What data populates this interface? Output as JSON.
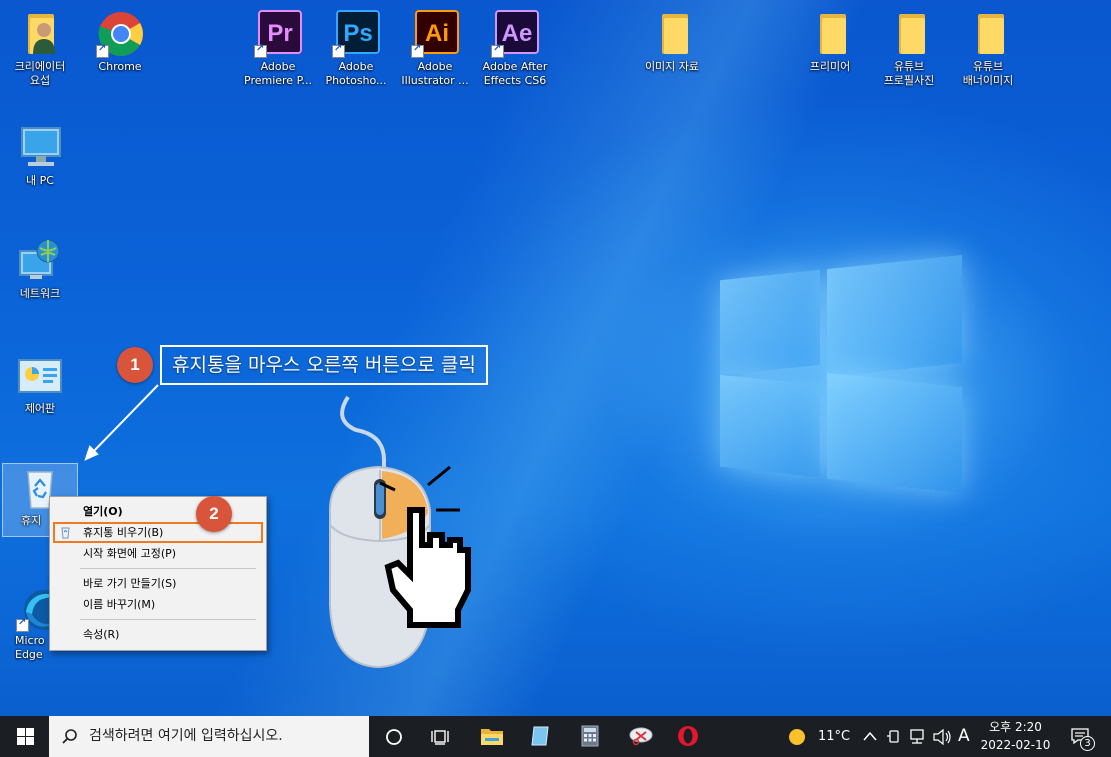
{
  "desktop": {
    "icons": [
      {
        "id": "creator",
        "label": "크리에이터\n요섭"
      },
      {
        "id": "chrome",
        "label": "Chrome"
      },
      {
        "id": "premiere",
        "label": "Adobe\nPremiere P...",
        "abbr": "Pr"
      },
      {
        "id": "photoshop",
        "label": "Adobe\nPhotosho...",
        "abbr": "Ps"
      },
      {
        "id": "illustrator",
        "label": "Adobe\nIllustrator ...",
        "abbr": "Ai"
      },
      {
        "id": "aftereffects",
        "label": "Adobe After\nEffects CS6",
        "abbr": "Ae"
      },
      {
        "id": "image-folder",
        "label": "이미지 자료"
      },
      {
        "id": "premiere-folder",
        "label": "프리미어"
      },
      {
        "id": "youtube-profile",
        "label": "유튜브\n프로필사진"
      },
      {
        "id": "youtube-banner",
        "label": "유튜브\n배너이미지"
      },
      {
        "id": "this-pc",
        "label": "내 PC"
      },
      {
        "id": "network",
        "label": "네트워크"
      },
      {
        "id": "control-panel",
        "label": "제어판"
      },
      {
        "id": "recycle-bin",
        "label": "휴지"
      },
      {
        "id": "edge",
        "label": "Micro\nEdge"
      }
    ]
  },
  "annotations": {
    "step1_number": "1",
    "step1_text": "휴지통을 마우스 오른쪽 버튼으로 클릭",
    "step2_number": "2"
  },
  "context_menu": {
    "items": [
      {
        "label": "열기(O)",
        "bold": true
      },
      {
        "label": "휴지통 비우기(B)",
        "highlight": true
      },
      {
        "label": "시작 화면에 고정(P)"
      },
      {
        "label": "바로 가기 만들기(S)"
      },
      {
        "label": "이름 바꾸기(M)"
      },
      {
        "label": "속성(R)"
      }
    ]
  },
  "taskbar": {
    "search_placeholder": "검색하려면 여기에 입력하십시오.",
    "weather_temp": "11°C",
    "ime_label": "A",
    "time": "오후 2:20",
    "date": "2022-02-10",
    "notification_count": "3"
  },
  "colors": {
    "accent_badge": "#d8543a",
    "highlight_border": "#f07a22",
    "premiere_bg": "#2a0a3a",
    "premiere_fg": "#e58cff",
    "photoshop_bg": "#001e36",
    "photoshop_fg": "#31a8ff",
    "illustrator_bg": "#330000",
    "illustrator_fg": "#ff9a00",
    "aftereffects_bg": "#1a0a3a",
    "aftereffects_fg": "#cf96fd"
  }
}
